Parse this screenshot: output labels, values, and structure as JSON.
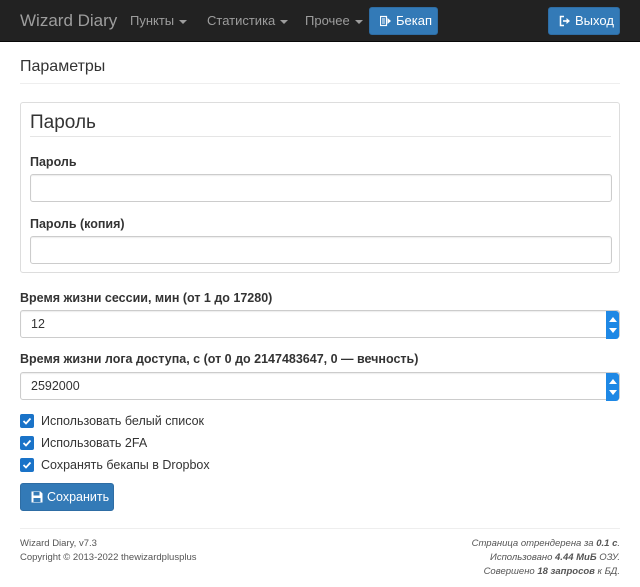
{
  "navbar": {
    "brand": "Wizard Diary",
    "items": [
      {
        "label": "Пункты"
      },
      {
        "label": "Статистика"
      },
      {
        "label": "Прочее"
      }
    ],
    "backup_label": "Бекап",
    "logout_label": "Выход"
  },
  "page": {
    "title": "Параметры"
  },
  "password_section": {
    "legend": "Пароль",
    "password_label": "Пароль",
    "password_value": "",
    "password_copy_label": "Пароль (копия)",
    "password_copy_value": ""
  },
  "session": {
    "label": "Время жизни сессии, мин (от 1 до 17280)",
    "value": "12"
  },
  "access_log": {
    "label": "Время жизни лога доступа, с (от 0 до 2147483647, 0 — вечность)",
    "value": "2592000"
  },
  "checkboxes": [
    {
      "label": "Использовать белый список",
      "checked": true
    },
    {
      "label": "Использовать 2FA",
      "checked": true
    },
    {
      "label": "Сохранять бекапы в Dropbox",
      "checked": true
    }
  ],
  "save_label": "Сохранить",
  "footer": {
    "version": "Wizard Diary, v7.3",
    "copyright": "Copyright © 2013-2022 thewizardplusplus",
    "render_prefix": "Страница отрендерена за ",
    "render_value": "0.1 с",
    "render_suffix": ".",
    "memory_prefix": "Использовано ",
    "memory_value": "4.44 МиБ",
    "memory_suffix": " ОЗУ.",
    "queries_prefix": "Совершено ",
    "queries_value": "18 запросов",
    "queries_suffix": " к БД."
  },
  "colors": {
    "navbar_bg": "#222222",
    "primary": "#337ab7",
    "checkbox": "#1a73c8"
  }
}
